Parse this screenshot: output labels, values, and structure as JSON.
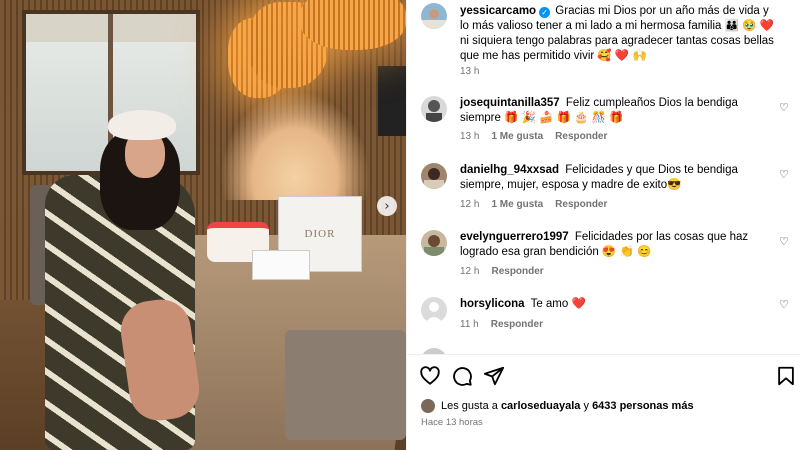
{
  "post": {
    "photo_alt_text": "DIOR",
    "next_arrow": "›"
  },
  "caption": {
    "username": "yessicarcamo",
    "verified_mark": "✓",
    "text": "Gracias mi Dios por un año más de vida y lo más valioso tener a mi lado a mi hermosa familia 👪 🥹 ❤️  ni siquiera tengo palabras para agradecer tantas cosas bellas que me has permitido vivir 🥰 ❤️ 🙌",
    "time": "13 h"
  },
  "comments": [
    {
      "username": "josequintanilla357",
      "text": "Feliz cumpleaños Dios la bendiga siempre 🎁 🎉 🍰 🎁 🎂 🎊 🎁",
      "time": "13 h",
      "likes": "1 Me gusta",
      "reply": "Responder"
    },
    {
      "username": "danielhg_94xxsad",
      "text": "Felicidades y que Dios te bendiga siempre, mujer, esposa y madre de exito😎",
      "time": "12 h",
      "likes": "1 Me gusta",
      "reply": "Responder"
    },
    {
      "username": "evelynguerrero1997",
      "text": "Felicidades por las cosas que haz logrado esa gran bendición 😍 👏 😊",
      "time": "12 h",
      "likes": "",
      "reply": "Responder"
    },
    {
      "username": "horsylicona",
      "text": "Te amo ❤️",
      "time": "11 h",
      "likes": "",
      "reply": "Responder"
    }
  ],
  "actions": {
    "likes_prefix": "Les gusta a",
    "liked_by_user": "carloseduayala",
    "likes_middle": "y",
    "others_count": "6433 personas más",
    "posted_ago": "Hace 13 horas"
  },
  "icons": {
    "heart": "like-heart-icon",
    "comment": "comment-bubble-icon",
    "share": "paper-plane-icon",
    "save": "bookmark-icon"
  },
  "colors": {
    "verified": "#0095f6",
    "meta_text": "#737373",
    "heart_red": "#e0242f"
  }
}
